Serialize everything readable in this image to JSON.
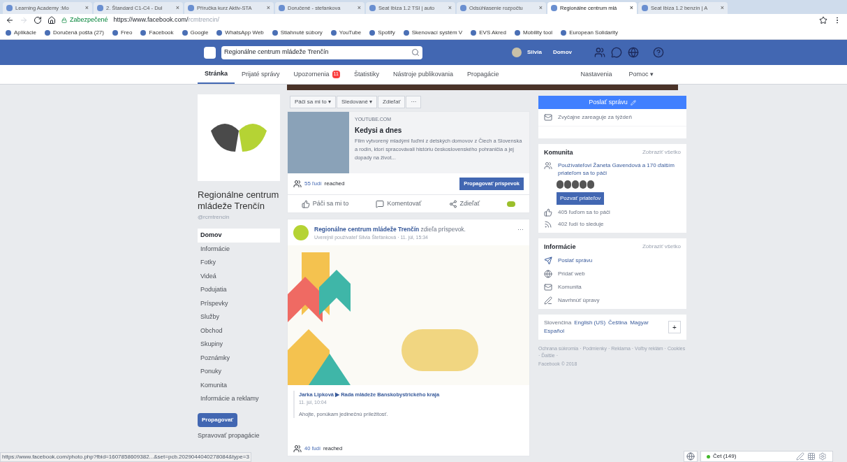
{
  "browser": {
    "tabs": [
      {
        "title": "Learning Academy :Mo",
        "selected": false
      },
      {
        "title": "2. Štandard C1-C4 - Dul",
        "selected": false
      },
      {
        "title": "Příručka kurz Aktiv-STA",
        "selected": false
      },
      {
        "title": "Doručené - stefankova",
        "selected": false
      },
      {
        "title": "Seat Ibiza 1.2 TSI | auto",
        "selected": false
      },
      {
        "title": "Odsúhlasenie rozpočtu",
        "selected": false
      },
      {
        "title": "Regionálne centrum mlá",
        "selected": true
      },
      {
        "title": "Seat Ibiza 1.2 benzín | A",
        "selected": false
      }
    ],
    "tab_close": "×",
    "secure_label": "Zabezpečené",
    "url": "https://www.facebook.com/",
    "url_path": "rcmtrencin/",
    "bookmarks": [
      "Aplikácie",
      "Doručená pošta (27)",
      "Freo",
      "Facebook",
      "Google",
      "WhatsApp Web",
      "Stiahnuté súbory",
      "YouTube",
      "Spotify",
      "Skenovací systém V",
      "EVS Akred",
      "Mobility tool",
      "European Solidarity"
    ]
  },
  "topbar": {
    "search": "Regionálne centrum mládeže Trenčín",
    "user": "Silvia",
    "home": "Domov"
  },
  "page_nav": [
    {
      "label": "Stránka",
      "selected": true
    },
    {
      "label": "Prijaté správy",
      "selected": false
    },
    {
      "label": "Upozornenia",
      "selected": false,
      "badge": "11"
    },
    {
      "label": "Štatistiky",
      "selected": false
    },
    {
      "label": "Nástroje publikovania",
      "selected": false
    },
    {
      "label": "Propagácie",
      "selected": false
    }
  ],
  "page_nav_right": [
    "Nastavenia",
    "Pomoc ▾"
  ],
  "sidebar": {
    "name": "Regionálne centrum mládeže Trenčín",
    "handle": "@rcmtrencin",
    "items": [
      {
        "label": "Domov",
        "selected": true
      },
      {
        "label": "Informácie",
        "selected": false
      },
      {
        "label": "Fotky",
        "selected": false
      },
      {
        "label": "Videá",
        "selected": false
      },
      {
        "label": "Podujatia",
        "selected": false
      },
      {
        "label": "Príspevky",
        "selected": false
      },
      {
        "label": "Služby",
        "selected": false
      },
      {
        "label": "Obchod",
        "selected": false
      },
      {
        "label": "Skupiny",
        "selected": false
      },
      {
        "label": "Poznámky",
        "selected": false
      },
      {
        "label": "Ponuky",
        "selected": false
      },
      {
        "label": "Komunita",
        "selected": false
      },
      {
        "label": "Informácie a reklamy",
        "selected": false
      }
    ],
    "promote": "Propagovať",
    "manage": "Spravovať propagácie"
  },
  "page_actions": [
    "Páči sa mi to ▾",
    "Sledované ▾",
    "Zdieľať",
    "···"
  ],
  "post1": {
    "source": "YOUTUBE.COM",
    "title": "Kedysi a dnes",
    "description": "Film vytvorený mladými ľuďmi z detských domovov z Čiech a Slovenska a rodín, ktorí spracovávali históriu československého pohraničia a jej dopady na život...",
    "reached_count": "55 ľudí",
    "reached": "reached",
    "boost": "Propagovať príspevok",
    "actions": [
      "Páči sa mi to",
      "Komentovať",
      "Zdieľať"
    ]
  },
  "post2": {
    "author": "Regionálne centrum mládeže Trenčín",
    "verb": "zdieľa príspevok.",
    "meta": "Uverejnil používateľ Silvia Štefánková · 11. júl, 15:34",
    "more": "···",
    "shared_author": "Jarka Lipková ▶ Rada mládeže Banskobystrického kraja",
    "shared_time": "11. júl, 10:04",
    "shared_text": "Ahojte, ponúkam jedinečnú príležitosť.",
    "reached_count": "40 ľudí",
    "reached": "reached"
  },
  "right": {
    "message": "Poslať správu",
    "response": "Zvyčajne zareaguje za týždeň",
    "community": {
      "title": "Komunita",
      "see_all": "Zobraziť všetko",
      "friends": "Používateľovi Žaneta Gavendová a 170 ďalším priateľom sa to páči",
      "invite": "Pozvať priateľov",
      "likes": "405 ľuďom sa to páči",
      "follows": "402 ľudí to sleduje"
    },
    "info": {
      "title": "Informácie",
      "see_all": "Zobraziť všetko",
      "items": [
        "Poslať správu",
        "Pridať web",
        "Komunita",
        "Navrhnúť úpravy"
      ]
    },
    "languages": [
      "Slovenčina",
      "English (US)",
      "Čeština",
      "Magyar",
      "Español"
    ],
    "add": "+",
    "footer": "Ochrana súkromia · Podmienky · Reklama · Voľby reklám · Cookies · Ďalšie ·",
    "copyright": "Facebook © 2018"
  },
  "status_url": "https://www.facebook.com/photo.php?fbid=1607858609382...&set=pcb.2029044040278084&type=3",
  "chat": "Čet (149)"
}
